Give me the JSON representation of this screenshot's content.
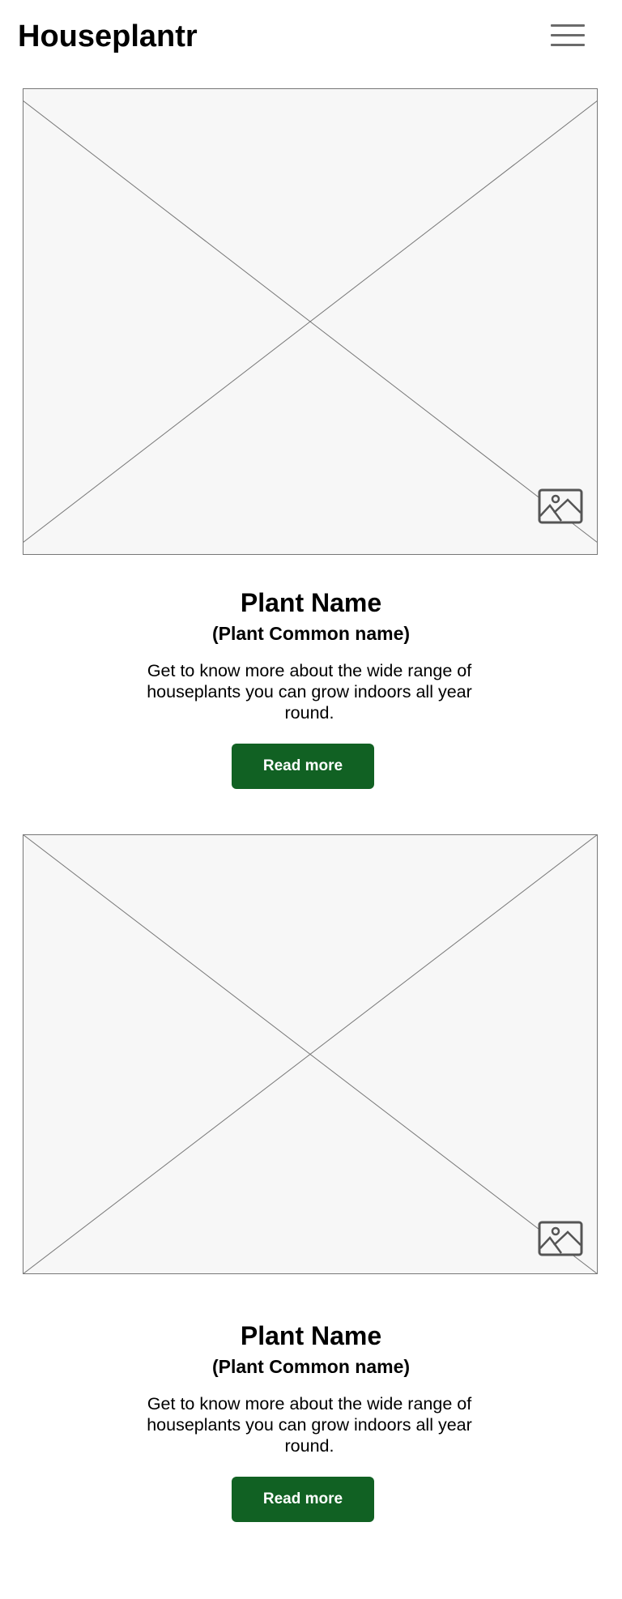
{
  "header": {
    "title": "Houseplantr",
    "menu_icon": "hamburger-menu-icon"
  },
  "cards": [
    {
      "image_icon": "image-placeholder-icon",
      "name": "Plant Name",
      "common_name": "(Plant Common name)",
      "description": "Get to know more about the wide range of houseplants you can grow indoors all year round.",
      "button_label": "Read more"
    },
    {
      "image_icon": "image-placeholder-icon",
      "name": "Plant Name",
      "common_name": "(Plant Common name)",
      "description": "Get to know more about the wide range of houseplants you can grow indoors all year round.",
      "button_label": "Read more"
    }
  ],
  "colors": {
    "button_background": "#116123",
    "button_text": "#ffffff",
    "image_placeholder_background": "#f7f7f7",
    "placeholder_stroke": "#777777"
  }
}
